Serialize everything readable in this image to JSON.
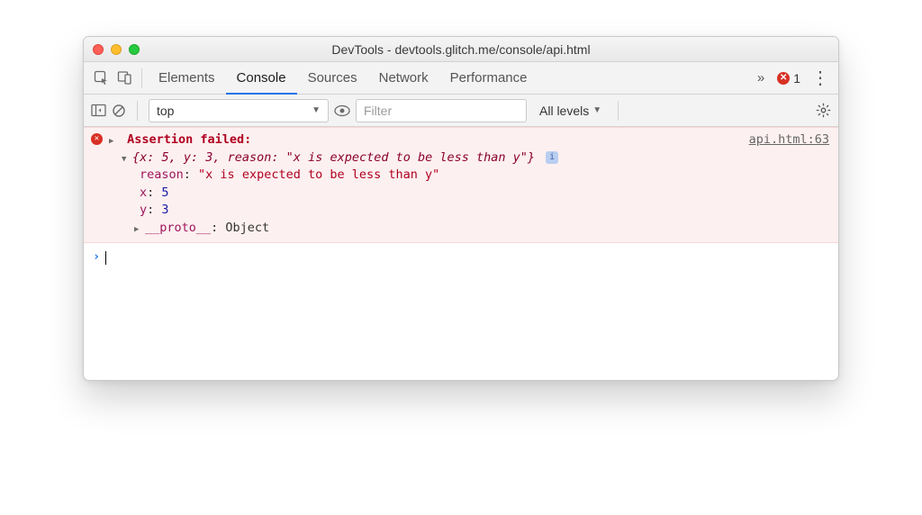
{
  "window": {
    "title": "DevTools - devtools.glitch.me/console/api.html"
  },
  "tabs": [
    "Elements",
    "Console",
    "Sources",
    "Network",
    "Performance"
  ],
  "activeTab": "Console",
  "overflowGlyph": "»",
  "errorCount": "1",
  "toolbar": {
    "context": "top",
    "filterPlaceholder": "Filter",
    "levels": "All levels"
  },
  "console": {
    "assertion_label": "Assertion failed:",
    "source": "api.html:63",
    "object_summary": "{x: 5, y: 3, reason: \"x is expected to be less than y\"}",
    "props": {
      "reason_key": "reason",
      "reason_val": "\"x is expected to be less than y\"",
      "x_key": "x",
      "x_val": "5",
      "y_key": "y",
      "y_val": "3"
    },
    "proto_key": "__proto__",
    "proto_val": "Object"
  }
}
